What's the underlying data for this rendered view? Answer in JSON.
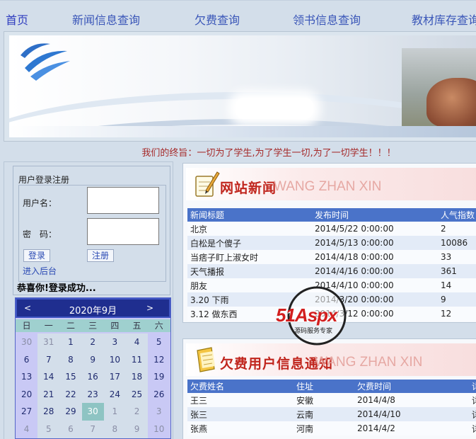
{
  "nav": {
    "items": [
      "首页",
      "新闻信息查询",
      "欠费查询",
      "领书信息查询",
      "教材库存查询"
    ]
  },
  "motto": "我们的终旨：一切为了学生,为了学生一切,为了一切学生！！！",
  "login": {
    "title": "用户登录注册",
    "username_label": "用户名：",
    "password_label": "密　码：",
    "login_button": "登录",
    "register_button": "注册",
    "admin_link": "进入后台",
    "success_message": "恭喜你!登录成功..."
  },
  "calendar": {
    "prev": "<",
    "next": ">",
    "month": "2020年9月",
    "weekdays": [
      "日",
      "一",
      "二",
      "三",
      "四",
      "五",
      "六"
    ],
    "weeks": [
      [
        "30",
        "31",
        "1",
        "2",
        "3",
        "4",
        "5"
      ],
      [
        "6",
        "7",
        "8",
        "9",
        "10",
        "11",
        "12"
      ],
      [
        "13",
        "14",
        "15",
        "16",
        "17",
        "18",
        "19"
      ],
      [
        "20",
        "21",
        "22",
        "23",
        "24",
        "25",
        "26"
      ],
      [
        "27",
        "28",
        "29",
        "30",
        "1",
        "2",
        "3"
      ],
      [
        "4",
        "5",
        "6",
        "7",
        "8",
        "9",
        "10"
      ]
    ],
    "today": "30"
  },
  "news": {
    "title": "网站新闻",
    "title_en": "WANG ZHAN XIN",
    "headers": [
      "新闻标题",
      "发布时间",
      "人气指数"
    ],
    "rows": [
      [
        "北京",
        "2014/5/22 0:00:00",
        "2"
      ],
      [
        "白松是个傻子",
        "2014/5/13 0:00:00",
        "10086"
      ],
      [
        "当痞子盯上淑女时",
        "2014/4/18 0:00:00",
        "33"
      ],
      [
        "天气播报",
        "2014/4/16 0:00:00",
        "361"
      ],
      [
        "朋友",
        "2014/4/10 0:00:00",
        "14"
      ],
      [
        "3.20 下雨",
        "2014/3/20 0:00:00",
        "9"
      ],
      [
        "3.12 做东西",
        "2014/3/12 0:00:00",
        "12"
      ]
    ]
  },
  "fees": {
    "title": "欠费用户信息通知",
    "title_en": "WANG ZHAN XIN",
    "headers": [
      "欠费姓名",
      "住址",
      "欠费时间",
      "详"
    ],
    "rows": [
      [
        "王三",
        "安徽",
        "2014/4/8",
        "详"
      ],
      [
        "张三",
        "云南",
        "2014/4/10",
        "详"
      ],
      [
        "张燕",
        "河南",
        "2014/4/2",
        "详"
      ]
    ]
  },
  "watermark": {
    "brand": "51Aspx",
    "sub": "源码服务专家"
  }
}
